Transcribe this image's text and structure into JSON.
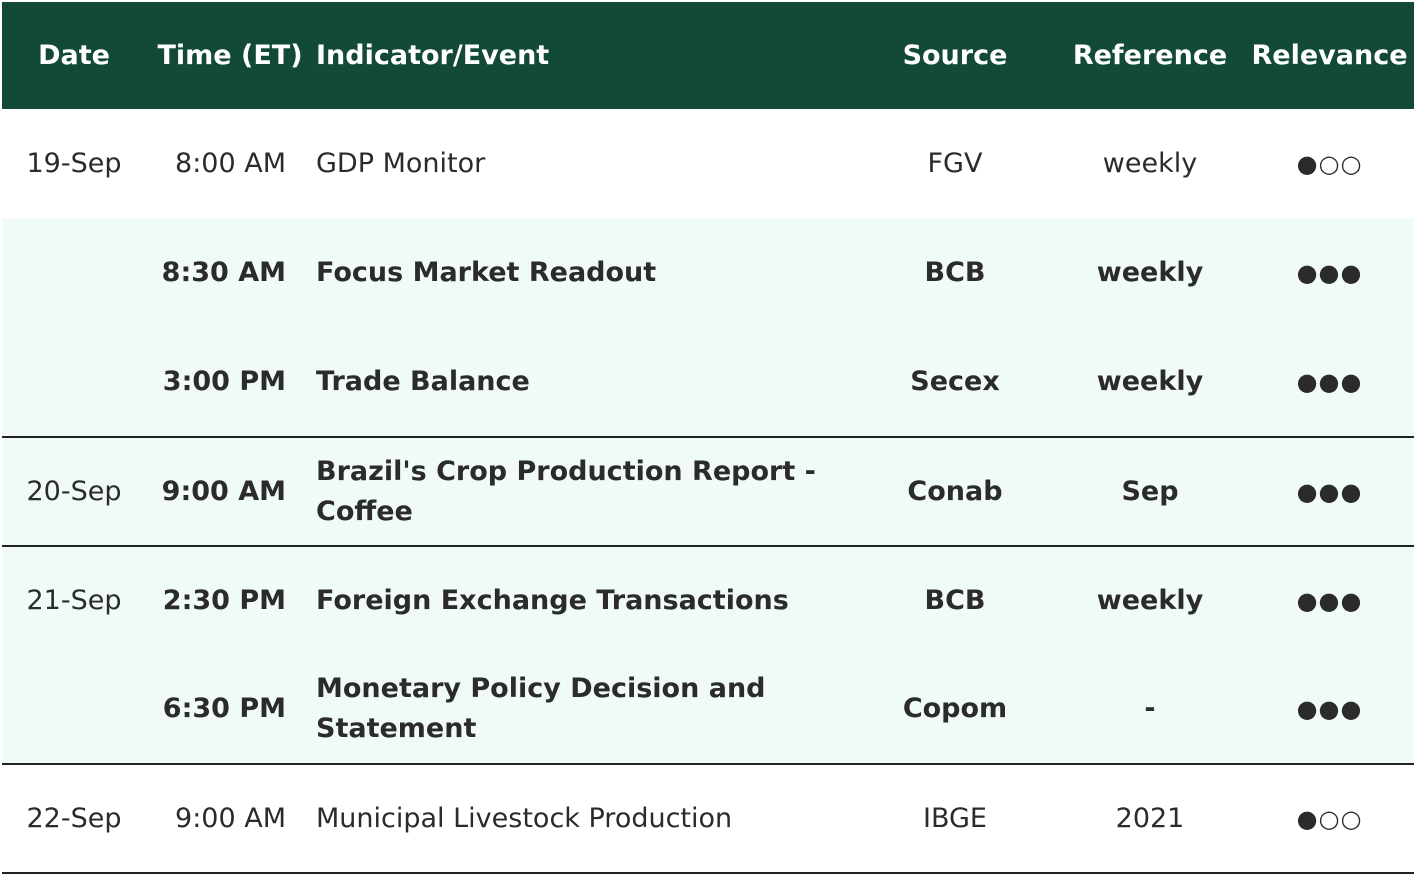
{
  "header": {
    "date": "Date",
    "time": "Time (ET)",
    "event": "Indicator/Event",
    "source": "Source",
    "reference": "Reference",
    "relevance": "Relevance"
  },
  "rows": [
    {
      "date": "19-Sep",
      "time": "8:00 AM",
      "event": "GDP Monitor",
      "source": "FGV",
      "reference": "weekly",
      "relevance": "●○○"
    },
    {
      "date": "",
      "time": "8:30 AM",
      "event": "Focus Market Readout",
      "source": "BCB",
      "reference": "weekly",
      "relevance": "●●●"
    },
    {
      "date": "",
      "time": "3:00 PM",
      "event": "Trade Balance",
      "source": "Secex",
      "reference": "weekly",
      "relevance": "●●●"
    },
    {
      "date": "20-Sep",
      "time": "9:00 AM",
      "event": "Brazil's Crop Production Report - Coffee",
      "source": "Conab",
      "reference": "Sep",
      "relevance": "●●●"
    },
    {
      "date": "21-Sep",
      "time": "2:30 PM",
      "event": "Foreign Exchange Transactions",
      "source": "BCB",
      "reference": "weekly",
      "relevance": "●●●"
    },
    {
      "date": "",
      "time": "6:30 PM",
      "event": "Monetary Policy Decision and Statement",
      "source": "Copom",
      "reference": "-",
      "relevance": "●●●"
    },
    {
      "date": "22-Sep",
      "time": "9:00 AM",
      "event": "Municipal Livestock Production",
      "source": "IBGE",
      "reference": "2021",
      "relevance": "●○○"
    }
  ],
  "colors": {
    "header_bg": "#134a36",
    "shaded_bg": "#f0faf6"
  }
}
